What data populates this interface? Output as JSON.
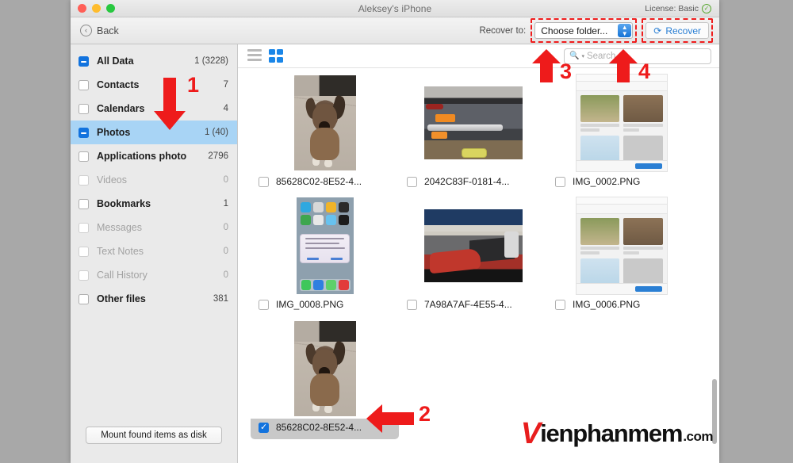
{
  "window": {
    "title": "Aleksey's iPhone",
    "license_label": "License: Basic",
    "license_badge_icon": "check-circle-icon",
    "traffic": {
      "close": "close-window-button",
      "minimize": "minimize-window-button",
      "maximize": "maximize-window-button"
    }
  },
  "toolbar": {
    "back_label": "Back",
    "back_icon": "chevron-left-circle-icon",
    "recover_to_label": "Recover to:",
    "folder_value": "Choose folder...",
    "folder_chevron_icon": "chevron-updown-icon",
    "recover_button_label": "Recover",
    "recover_icon": "refresh-icon"
  },
  "sidebar": {
    "items": [
      {
        "label": "All Data",
        "count": "1 (3228)",
        "state": "mixed",
        "disabled": false
      },
      {
        "label": "Contacts",
        "count": "7",
        "state": "empty",
        "disabled": false
      },
      {
        "label": "Calendars",
        "count": "4",
        "state": "empty",
        "disabled": false
      },
      {
        "label": "Photos",
        "count": "1 (40)",
        "state": "mixed",
        "disabled": false,
        "active": true
      },
      {
        "label": "Applications photo",
        "count": "2796",
        "state": "empty",
        "disabled": false
      },
      {
        "label": "Videos",
        "count": "0",
        "state": "dim",
        "disabled": true
      },
      {
        "label": "Bookmarks",
        "count": "1",
        "state": "empty",
        "disabled": false
      },
      {
        "label": "Messages",
        "count": "0",
        "state": "dim",
        "disabled": true
      },
      {
        "label": "Text Notes",
        "count": "0",
        "state": "dim",
        "disabled": true
      },
      {
        "label": "Call History",
        "count": "0",
        "state": "dim",
        "disabled": true
      },
      {
        "label": "Other files",
        "count": "381",
        "state": "empty",
        "disabled": false
      }
    ],
    "mount_button_label": "Mount found items as disk"
  },
  "content": {
    "view_list_icon": "list-view-icon",
    "view_grid_icon": "grid-view-icon",
    "active_view": "grid",
    "search": {
      "placeholder": "Search",
      "value": "",
      "icon": "search-icon"
    },
    "files": [
      {
        "name": "85628C02-8E52-4...",
        "checked": false,
        "thumb": "dog-portrait",
        "selected": false
      },
      {
        "name": "2042C83F-0181-4...",
        "checked": false,
        "thumb": "desk-landscape",
        "selected": false
      },
      {
        "name": "IMG_0002.PNG",
        "checked": false,
        "thumb": "photos-screenshot",
        "selected": false
      },
      {
        "name": "IMG_0008.PNG",
        "checked": false,
        "thumb": "iphone-homescreen",
        "selected": false
      },
      {
        "name": "7A98A7AF-4E55-4...",
        "checked": false,
        "thumb": "drive-landscape",
        "selected": false
      },
      {
        "name": "IMG_0006.PNG",
        "checked": false,
        "thumb": "photos-screenshot",
        "selected": false
      },
      {
        "name": "85628C02-8E52-4...",
        "checked": true,
        "thumb": "dog-portrait",
        "selected": true
      }
    ]
  },
  "annotations": [
    {
      "number": "1",
      "target": "sidebar-photos-row"
    },
    {
      "number": "2",
      "target": "selected-file-cell"
    },
    {
      "number": "3",
      "target": "choose-folder-dropdown"
    },
    {
      "number": "4",
      "target": "recover-button"
    }
  ],
  "watermark": {
    "logo": "V",
    "name": "ienphanmem",
    "tld": ".com",
    "accent": "#e81d1d"
  }
}
